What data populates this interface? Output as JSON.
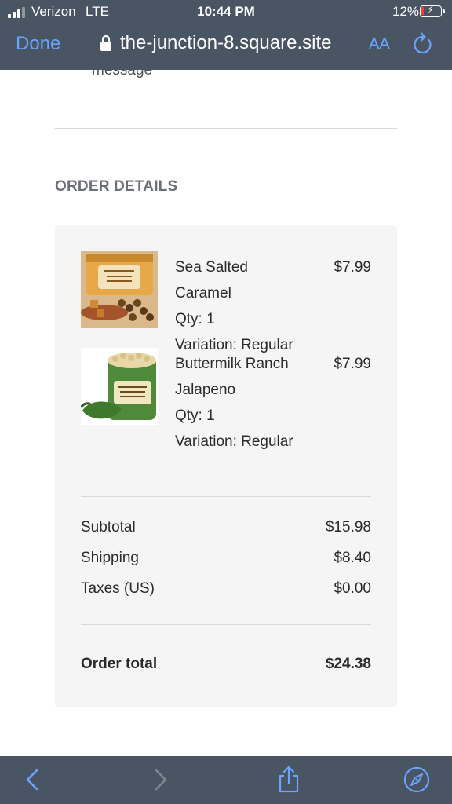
{
  "status_bar": {
    "carrier": "Verizon",
    "network": "LTE",
    "time": "10:44 PM",
    "battery_pct": "12%",
    "battery_level": 0.12,
    "battery_color": "#ff3b30"
  },
  "browser": {
    "done_label": "Done",
    "url": "the-junction-8.square.site",
    "text_size_label": "AA",
    "icons": [
      "lock-icon",
      "reload-icon",
      "back-icon",
      "forward-icon",
      "share-icon",
      "compass-icon"
    ],
    "accent_color": "#6aa4ff"
  },
  "page": {
    "message_fragment": "message",
    "section_title": "ORDER DETAILS",
    "items": [
      {
        "name": "Sea Salted Caramel",
        "qty": "Qty: 1",
        "variation": "Variation: Regular",
        "price": "$7.99"
      },
      {
        "name_line1": "Buttermilk Ranch",
        "name_line2": "Jalapeno",
        "qty": "Qty: 1",
        "variation": "Variation: Regular",
        "price": "$7.99"
      }
    ],
    "summary": {
      "subtotal_label": "Subtotal",
      "subtotal_value": "$15.98",
      "shipping_label": "Shipping",
      "shipping_value": "$8.40",
      "taxes_label": "Taxes (US)",
      "taxes_value": "$0.00",
      "total_label": "Order total",
      "total_value": "$24.38"
    }
  }
}
